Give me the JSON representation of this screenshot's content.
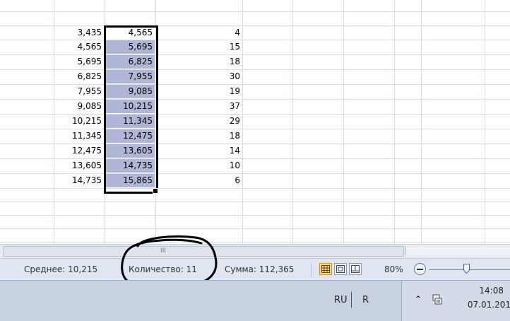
{
  "sheet": {
    "rows": [
      {
        "a": "3,435",
        "b": "4,565",
        "c": "4"
      },
      {
        "a": "4,565",
        "b": "5,695",
        "c": "15"
      },
      {
        "a": "5,695",
        "b": "6,825",
        "c": "18"
      },
      {
        "a": "6,825",
        "b": "7,955",
        "c": "30"
      },
      {
        "a": "7,955",
        "b": "9,085",
        "c": "19"
      },
      {
        "a": "9,085",
        "b": "10,215",
        "c": "37"
      },
      {
        "a": "10,215",
        "b": "11,345",
        "c": "29"
      },
      {
        "a": "11,345",
        "b": "12,475",
        "c": "18"
      },
      {
        "a": "12,475",
        "b": "13,605",
        "c": "14"
      },
      {
        "a": "13,605",
        "b": "14,735",
        "c": "10"
      },
      {
        "a": "14,735",
        "b": "15,865",
        "c": "6"
      }
    ],
    "selection_color": "#b0b7d6"
  },
  "scrollbar": {
    "grip": "III"
  },
  "statusbar": {
    "average": "Среднее: 10,215",
    "count": "Количество: 11",
    "sum": "Сумма: 112,365",
    "zoom": "80%",
    "zoom_level_percent": 80,
    "views": [
      "normal-view-icon",
      "page-layout-icon",
      "page-break-preview-icon"
    ]
  },
  "taskbar": {
    "lang": "RU",
    "keyboard": "R",
    "tray_chevron": "⌃",
    "clock_time": "14:08",
    "clock_date": "07.01.201"
  },
  "annotation": {
    "color": "#000000"
  }
}
